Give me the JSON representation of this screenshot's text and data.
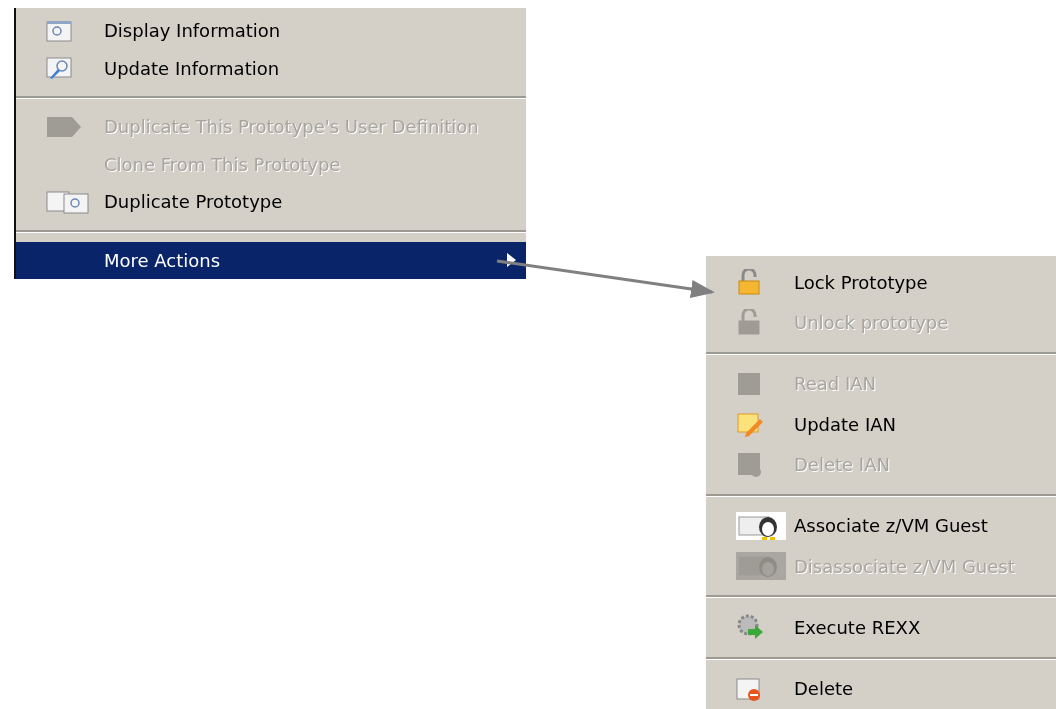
{
  "menus": [
    {
      "items": [
        {
          "kind": "item",
          "label": "Display Information",
          "disabled": false,
          "selected": false
        },
        {
          "kind": "item",
          "label": "Update Information",
          "disabled": false,
          "selected": false
        },
        {
          "kind": "separator"
        },
        {
          "kind": "item",
          "label": "Duplicate This Prototype's User Definition",
          "disabled": true,
          "selected": false
        },
        {
          "kind": "item",
          "label": "Clone From This Prototype",
          "disabled": true,
          "selected": false
        },
        {
          "kind": "item",
          "label": "Duplicate Prototype",
          "disabled": false,
          "selected": false
        },
        {
          "kind": "separator"
        },
        {
          "kind": "submenu",
          "label": "More Actions",
          "disabled": false,
          "selected": true
        }
      ]
    },
    {
      "items": [
        {
          "kind": "item",
          "label": "Lock Prototype",
          "disabled": false,
          "selected": false
        },
        {
          "kind": "item",
          "label": "Unlock prototype",
          "disabled": true,
          "selected": false
        },
        {
          "kind": "separator"
        },
        {
          "kind": "item",
          "label": "Read IAN",
          "disabled": true,
          "selected": false
        },
        {
          "kind": "item",
          "label": "Update IAN",
          "disabled": false,
          "selected": false
        },
        {
          "kind": "item",
          "label": "Delete IAN",
          "disabled": true,
          "selected": false
        },
        {
          "kind": "separator"
        },
        {
          "kind": "item",
          "label": "Associate z/VM Guest",
          "disabled": false,
          "selected": false
        },
        {
          "kind": "item",
          "label": "Disassociate z/VM Guest",
          "disabled": true,
          "selected": false
        },
        {
          "kind": "separator"
        },
        {
          "kind": "item",
          "label": "Execute REXX",
          "disabled": false,
          "selected": false
        },
        {
          "kind": "separator"
        },
        {
          "kind": "item",
          "label": "Delete",
          "disabled": false,
          "selected": false
        }
      ]
    }
  ]
}
